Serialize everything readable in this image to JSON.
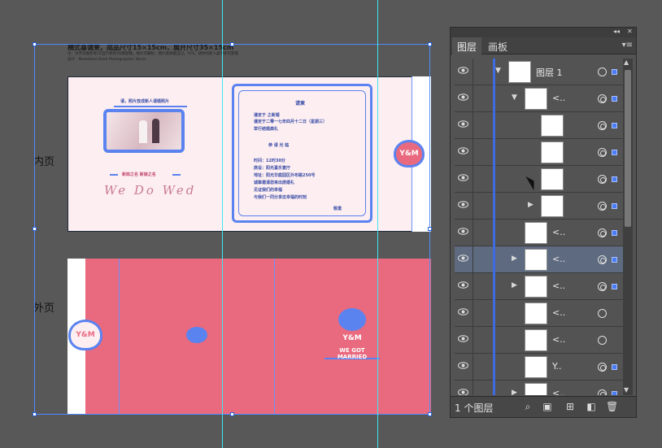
{
  "document": {
    "spec_title": "横式喜请柬，成品尺寸15×15cm，展开尺寸35×15cm",
    "spec_note": "注：文字仅做参考(可自行修改)均需替换。照片可删除，图片再将着自己。YES，请你的新人喜字即可获取",
    "spec_note2": "设计：Madeleine Reed   Photographer: Kevin",
    "inner_label": "内页",
    "outer_label": "外页",
    "inner": {
      "header_text": "请，照片放成新人请婚照片",
      "bride_groom": "新郎之名  新娘之名",
      "script_text": "We Do Wed",
      "invite_title": "请柬",
      "invite_lines": [
        "谨定于  之新婚",
        "谨定于二零一七年四月十二日（星期三）",
        "举行结婚典礼",
        "恭  请        光  临",
        "时间：12时30分",
        "席设：阳光喜乐宴厅",
        "地址：阳光华庭园区外布路250号",
        "诚挚邀请您来出席婚礼",
        "见证我们的幸福",
        "与我们一同分享这幸福的时刻"
      ],
      "sign": "敬邀",
      "logo_text": "Y&M"
    },
    "outer": {
      "logo_text": "Y&M",
      "tagline": "WE GOT MARRIED"
    }
  },
  "panel": {
    "collapse_label": "◂◂",
    "close_label": "✕",
    "tabs": [
      {
        "label": "图层",
        "active": true
      },
      {
        "label": "画板",
        "active": false
      }
    ],
    "menu_label": "▾≡",
    "layers": [
      {
        "label": "图层 1",
        "indent": 0,
        "expand": "open",
        "target": "single",
        "selected_square": true
      },
      {
        "label": "<..",
        "indent": 1,
        "expand": "open",
        "target": "double",
        "selected_square": true
      },
      {
        "label": "",
        "indent": 2,
        "expand": "",
        "target": "double",
        "selected_square": true
      },
      {
        "label": "",
        "indent": 2,
        "expand": "",
        "target": "double",
        "selected_square": true
      },
      {
        "label": "",
        "indent": 2,
        "expand": "",
        "target": "double",
        "selected_square": true
      },
      {
        "label": "",
        "indent": 2,
        "expand": "closed",
        "target": "double",
        "selected_square": true
      },
      {
        "label": "<..",
        "indent": 1,
        "expand": "",
        "target": "double",
        "selected_square": true
      },
      {
        "label": "<..",
        "indent": 1,
        "expand": "closed",
        "target": "double",
        "selected_square": true,
        "highlight": true
      },
      {
        "label": "<..",
        "indent": 1,
        "expand": "closed",
        "target": "double",
        "selected_square": true
      },
      {
        "label": "<..",
        "indent": 1,
        "expand": "",
        "target": "single",
        "selected_square": false
      },
      {
        "label": "<..",
        "indent": 1,
        "expand": "",
        "target": "single",
        "selected_square": false
      },
      {
        "label": "Y..",
        "indent": 1,
        "expand": "",
        "target": "double",
        "selected_square": true
      },
      {
        "label": "<..",
        "indent": 1,
        "expand": "closed",
        "target": "double",
        "selected_square": true
      }
    ],
    "footer_label": "1 个图层",
    "footer_icons": [
      "search-icon",
      "clip-icon",
      "new-sublayer-icon",
      "new-layer-icon",
      "trash-icon"
    ],
    "footer_glyphs": [
      "⌕",
      "▣",
      "⊞",
      "◧",
      "🗑"
    ],
    "colors": {
      "layer": "#3f6be0",
      "accent_pink": "#e96a7f",
      "guide": "#3ee8ef"
    }
  }
}
